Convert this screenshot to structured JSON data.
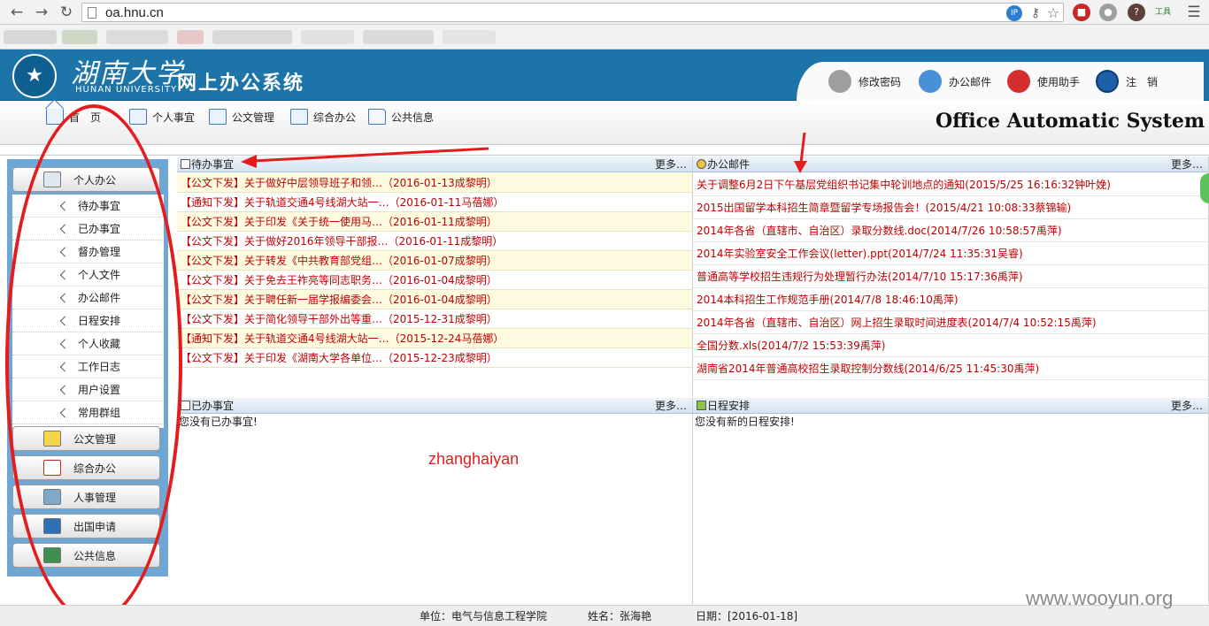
{
  "browser": {
    "url": "oa.hnu.cn",
    "ext_tools_label": "工具"
  },
  "header": {
    "logo_cn": "湖南大学",
    "logo_en": "HUNAN UNIVERSITY",
    "system_title": "网上办公系统",
    "actions": [
      {
        "label": "修改密码",
        "icon": "key-icon"
      },
      {
        "label": "办公邮件",
        "icon": "mail-icon"
      },
      {
        "label": "使用助手",
        "icon": "help-icon"
      },
      {
        "label": "注　销",
        "icon": "logout-icon"
      }
    ]
  },
  "main_nav": {
    "items": [
      "首　页",
      "个人事宜",
      "公文管理",
      "综合办公",
      "公共信息"
    ],
    "oa_title": "Office Automatic System"
  },
  "sidebar": {
    "groups": [
      "个人办公",
      "公文管理",
      "综合办公",
      "人事管理",
      "出国申请",
      "公共信息"
    ],
    "items": [
      "待办事宜",
      "已办事宜",
      "督办管理",
      "个人文件",
      "办公邮件",
      "日程安排",
      "个人收藏",
      "工作日志",
      "用户设置",
      "常用群组"
    ]
  },
  "panels": {
    "todo": {
      "title": "待办事宜",
      "more": "更多…",
      "rows": [
        "【公文下发】关于做好中层领导班子和领…（2016-01-13成黎明）",
        "【通知下发】关于轨道交通4号线湖大站一…（2016-01-11马蓓娜）",
        "【公文下发】关于印发《关于统一使用马…（2016-01-11成黎明）",
        "【公文下发】关于做好2016年领导干部报…（2016-01-11成黎明）",
        "【公文下发】关于转发《中共教育部党组…（2016-01-07成黎明）",
        "【公文下发】关于免去王祚亮等同志职务…（2016-01-04成黎明）",
        "【公文下发】关于聘任新一届学报编委会…（2016-01-04成黎明）",
        "【公文下发】关于简化领导干部外出等重…（2015-12-31成黎明）",
        "【通知下发】关于轨道交通4号线湖大站一…（2015-12-24马蓓娜）",
        "【公文下发】关于印发《湖南大学各单位…（2015-12-23成黎明）"
      ]
    },
    "mail": {
      "title": "办公邮件",
      "more": "更多…",
      "rows": [
        "关于调整6月2日下午基层党组织书记集中轮训地点的通知(2015/5/25 16:16:32钟叶娩)",
        "2015出国留学本科招生简章暨留学专场报告会！(2015/4/21 10:08:33蔡锦输)",
        "2014年各省（直辖市、自治区）录取分数线.doc(2014/7/26 10:58:57禹萍)",
        "2014年实验室安全工作会议(letter).ppt(2014/7/24 11:35:31吴睿)",
        "普通高等学校招生违规行为处理暂行办法(2014/7/10 15:17:36禹萍)",
        "2014本科招生工作规范手册(2014/7/8 18:46:10禹萍)",
        "2014年各省（直辖市、自治区）网上招生录取时间进度表(2014/7/4 10:52:15禹萍)",
        "全国分数.xls(2014/7/2 15:53:39禹萍)",
        "湖南省2014年普通高校招生录取控制分数线(2014/6/25 11:45:30禹萍)"
      ]
    },
    "done": {
      "title": "已办事宜",
      "more": "更多…",
      "empty": "您没有已办事宜!"
    },
    "schedule": {
      "title": "日程安排",
      "more": "更多…",
      "empty": "您没有新的日程安排!"
    }
  },
  "overlay": {
    "name_label": "zhanghaiyan",
    "watermark": "www.wooyun.org"
  },
  "footer": {
    "unit": "单位：电气与信息工程学院",
    "name": "姓名：张海艳",
    "date": "日期：[2016-01-18]"
  },
  "colors": {
    "header_blue": "#1c74a8",
    "sidebar_blue": "#6ea6d6",
    "link_red": "#c00000",
    "annotation_red": "#e61c1c"
  }
}
